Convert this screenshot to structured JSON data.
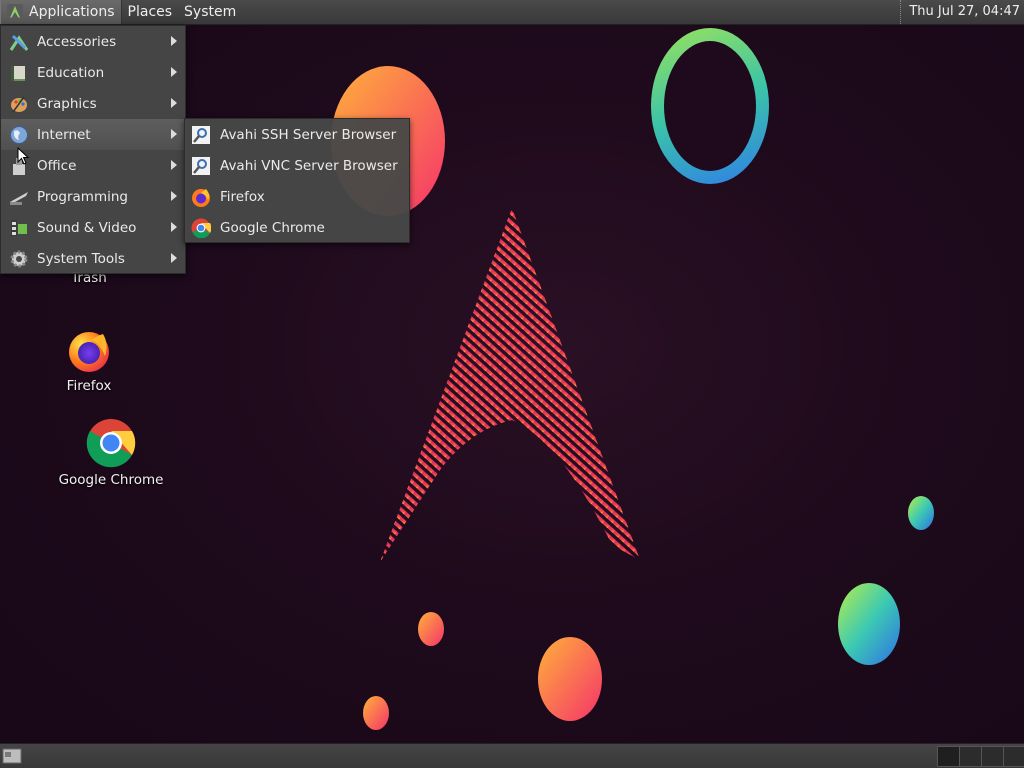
{
  "top_panel": {
    "menus": [
      "Applications",
      "Places",
      "System"
    ],
    "clock": "Thu Jul 27, 04:47"
  },
  "applications_menu": {
    "items": [
      {
        "label": "Accessories",
        "icon": "accessories-icon",
        "has_submenu": true
      },
      {
        "label": "Education",
        "icon": "education-icon",
        "has_submenu": true
      },
      {
        "label": "Graphics",
        "icon": "graphics-icon",
        "has_submenu": true
      },
      {
        "label": "Internet",
        "icon": "internet-globe-icon",
        "has_submenu": true,
        "highlighted": true
      },
      {
        "label": "Office",
        "icon": "office-icon",
        "has_submenu": true
      },
      {
        "label": "Programming",
        "icon": "programming-icon",
        "has_submenu": true
      },
      {
        "label": "Sound & Video",
        "icon": "sound-video-icon",
        "has_submenu": true
      },
      {
        "label": "System Tools",
        "icon": "system-tools-gear-icon",
        "has_submenu": true
      }
    ]
  },
  "internet_submenu": {
    "items": [
      {
        "label": "Avahi SSH Server Browser",
        "icon": "avahi-icon"
      },
      {
        "label": "Avahi VNC Server Browser",
        "icon": "avahi-icon"
      },
      {
        "label": "Firefox",
        "icon": "firefox-icon"
      },
      {
        "label": "Google Chrome",
        "icon": "chrome-icon"
      }
    ]
  },
  "desktop_icons": [
    {
      "label": "Trash",
      "icon": "trash-icon"
    },
    {
      "label": "Firefox",
      "icon": "firefox-icon"
    },
    {
      "label": "Google Chrome",
      "icon": "chrome-icon"
    }
  ],
  "colors": {
    "background": "#1e0a1c",
    "panel": "#3f3f3f",
    "menu": "#484848",
    "arch_logo_pink": "#e0245e",
    "arch_logo_yellow": "#f6c338"
  }
}
